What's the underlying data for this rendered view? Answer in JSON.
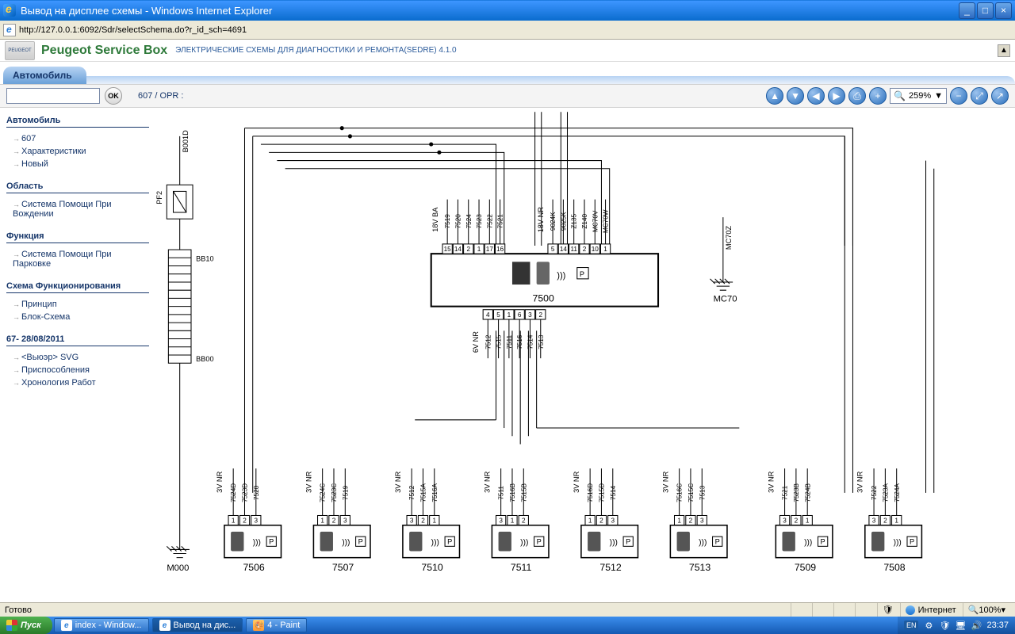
{
  "window": {
    "title": "Вывод на дисплее схемы - Windows Internet Explorer",
    "url": "http://127.0.0.1:6092/Sdr/selectSchema.do?r_id_sch=4691"
  },
  "header": {
    "logo_text": "PEUGEOT",
    "brand": "Peugeot Service Box",
    "subtitle": "ЭЛЕКТРИЧЕСКИЕ СХЕМЫ ДЛЯ ДИАГНОСТИКИ И РЕМОНТА(SEDRE) 4.1.0"
  },
  "tab": {
    "label": "Автомобиль"
  },
  "toolbar": {
    "ok": "OK",
    "breadcrumb": "607  /  OPR :",
    "zoom": "259%",
    "zoom_arrow": "▼"
  },
  "sidebar": {
    "groups": [
      {
        "title": "Автомобиль",
        "items": [
          "607",
          "Характеристики",
          "Новый"
        ]
      },
      {
        "title": "Область",
        "items": [
          "Система Помощи При Вождении"
        ]
      },
      {
        "title": "Функция",
        "items": [
          "Система Помощи При Парковке"
        ]
      },
      {
        "title": "Схема Функционирования",
        "items": [
          "Принцип",
          "Блок-Схема"
        ]
      },
      {
        "title": "67- 28/08/2011",
        "items": [
          "<Вьюэр> SVG",
          "Приспособления",
          "Хронология Работ"
        ]
      }
    ]
  },
  "diagram": {
    "main_block": "7500",
    "ground_left": "M000",
    "ground_right": "MC70",
    "mc70z": "MC70Z",
    "b001d": "B001D",
    "bb10": "BB10",
    "bb00": "BB00",
    "pf2": "PF2",
    "top_left": {
      "volt": "18V  BA",
      "wires": [
        "7519",
        "7520",
        "7524",
        "7523",
        "7522",
        "7521"
      ],
      "pins": [
        "15",
        "14",
        "2",
        "1",
        "17",
        "16"
      ]
    },
    "top_right": {
      "volt": "18V  NR",
      "wires": [
        "9024K",
        "9025K",
        "Z135",
        "Z140",
        "MC70V",
        "MC70W"
      ],
      "pins": [
        "5",
        "14",
        "11",
        "2",
        "10",
        "1"
      ]
    },
    "bottom_conn": {
      "volt": "6V  NR",
      "wires": [
        "7512",
        "7515",
        "7511",
        "7516",
        "7514",
        "7513"
      ],
      "pins": [
        "4",
        "5",
        "1",
        "6",
        "3",
        "2"
      ]
    },
    "sensors": [
      {
        "id": "7506",
        "volt": "3V  NR",
        "wires": [
          "7524D",
          "7523D",
          "7520"
        ],
        "pins": [
          "1",
          "2",
          "3"
        ]
      },
      {
        "id": "7507",
        "volt": "3V  NR",
        "wires": [
          "7524C",
          "7523C",
          "7519"
        ],
        "pins": [
          "1",
          "2",
          "3"
        ]
      },
      {
        "id": "7510",
        "volt": "3V  NR",
        "wires": [
          "7512",
          "7515A",
          "7516A"
        ],
        "pins": [
          "3",
          "2",
          "1"
        ]
      },
      {
        "id": "7511",
        "volt": "3V  NR",
        "wires": [
          "7511",
          "7516B",
          "7515B"
        ],
        "pins": [
          "3",
          "1",
          "2"
        ]
      },
      {
        "id": "7512",
        "volt": "3V  NR",
        "wires": [
          "7516D",
          "7515D",
          "7514"
        ],
        "pins": [
          "1",
          "2",
          "3"
        ]
      },
      {
        "id": "7513",
        "volt": "3V  NR",
        "wires": [
          "7516C",
          "7515C",
          "7513"
        ],
        "pins": [
          "1",
          "2",
          "3"
        ]
      },
      {
        "id": "7509",
        "volt": "3V  NR",
        "wires": [
          "7521",
          "7523B",
          "7524B"
        ],
        "pins": [
          "3",
          "2",
          "1"
        ]
      },
      {
        "id": "7508",
        "volt": "3V  NR",
        "wires": [
          "7522",
          "7523A",
          "7524A"
        ],
        "pins": [
          "3",
          "2",
          "1"
        ]
      }
    ]
  },
  "status": {
    "ready": "Готово",
    "zone": "Интернет",
    "zoom": "100%"
  },
  "taskbar": {
    "start": "Пуск",
    "buttons": [
      "index - Window...",
      "Вывод на дис...",
      "4 - Paint"
    ],
    "lang": "EN",
    "clock": "23:37"
  }
}
